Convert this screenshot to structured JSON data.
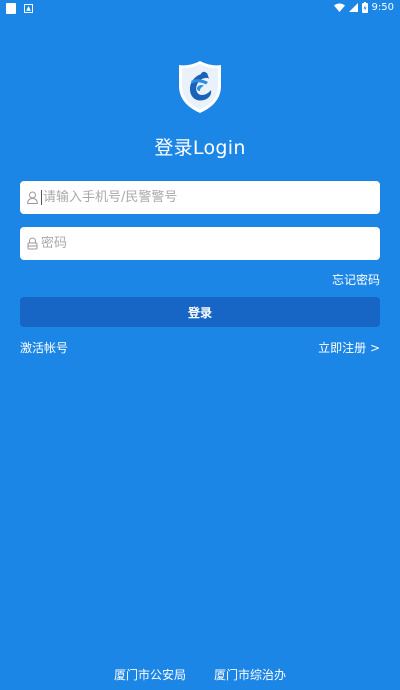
{
  "status_bar": {
    "time": "9:50",
    "battery_icon": "battery-charging-icon",
    "wifi_icon": "wifi-icon",
    "signal_icon": "signal-icon"
  },
  "app": {
    "logo_icon": "police-shield-logo-icon",
    "title": "登录Login"
  },
  "form": {
    "username_placeholder": "请输入手机号/民警警号",
    "password_placeholder": "密码",
    "forgot_password": "忘记密码",
    "login_button": "登录",
    "activate_account": "激活帐号",
    "register": "立即注册 >"
  },
  "footer": {
    "org1": "厦门市公安局",
    "org2": "厦门市综治办"
  },
  "colors": {
    "background": "#1c86e6",
    "button": "#1765c4",
    "field_bg": "#ffffff",
    "placeholder": "#a9a9a9"
  }
}
